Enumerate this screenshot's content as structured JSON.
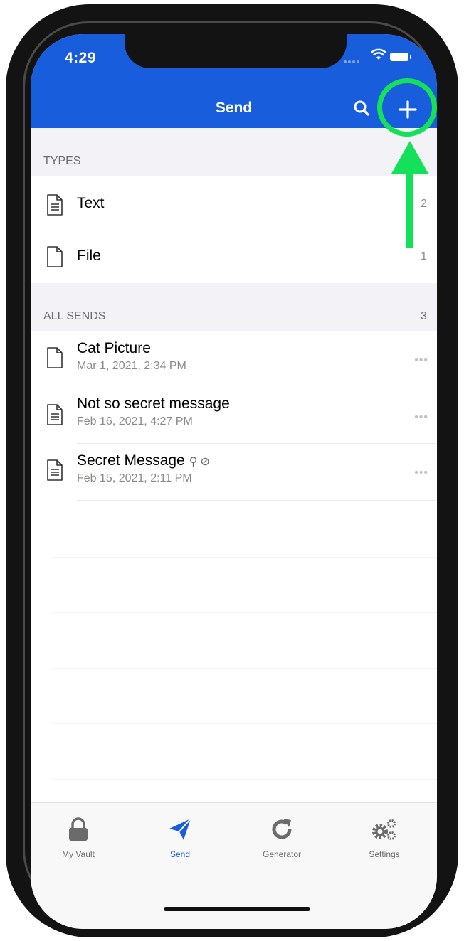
{
  "status_bar": {
    "time": "4:29"
  },
  "header": {
    "title": "Send"
  },
  "types_section": {
    "label": "TYPES"
  },
  "types": [
    {
      "label": "Text",
      "count": "2",
      "icon": "text-document-icon"
    },
    {
      "label": "File",
      "count": "1",
      "icon": "file-icon"
    }
  ],
  "sends_section": {
    "label": "ALL SENDS",
    "count": "3"
  },
  "sends": [
    {
      "name": "Cat Picture",
      "date": "Mar 1, 2021, 2:34 PM",
      "icon": "file-icon",
      "more": "•••"
    },
    {
      "name": "Not so secret message",
      "date": "Feb 16, 2021, 4:27 PM",
      "icon": "text-document-icon",
      "more": "•••"
    },
    {
      "name": "Secret Message",
      "date": "Feb 15, 2021, 2:11 PM",
      "icon": "text-document-icon",
      "badges": "⚲⊘",
      "more": "•••"
    }
  ],
  "tabs": [
    {
      "label": "My Vault",
      "icon": "lock-icon"
    },
    {
      "label": "Send",
      "icon": "paper-plane-icon",
      "active": true
    },
    {
      "label": "Generator",
      "icon": "refresh-icon"
    },
    {
      "label": "Settings",
      "icon": "gears-icon"
    }
  ],
  "colors": {
    "brand": "#175ddc",
    "annotation": "#14e05a"
  }
}
